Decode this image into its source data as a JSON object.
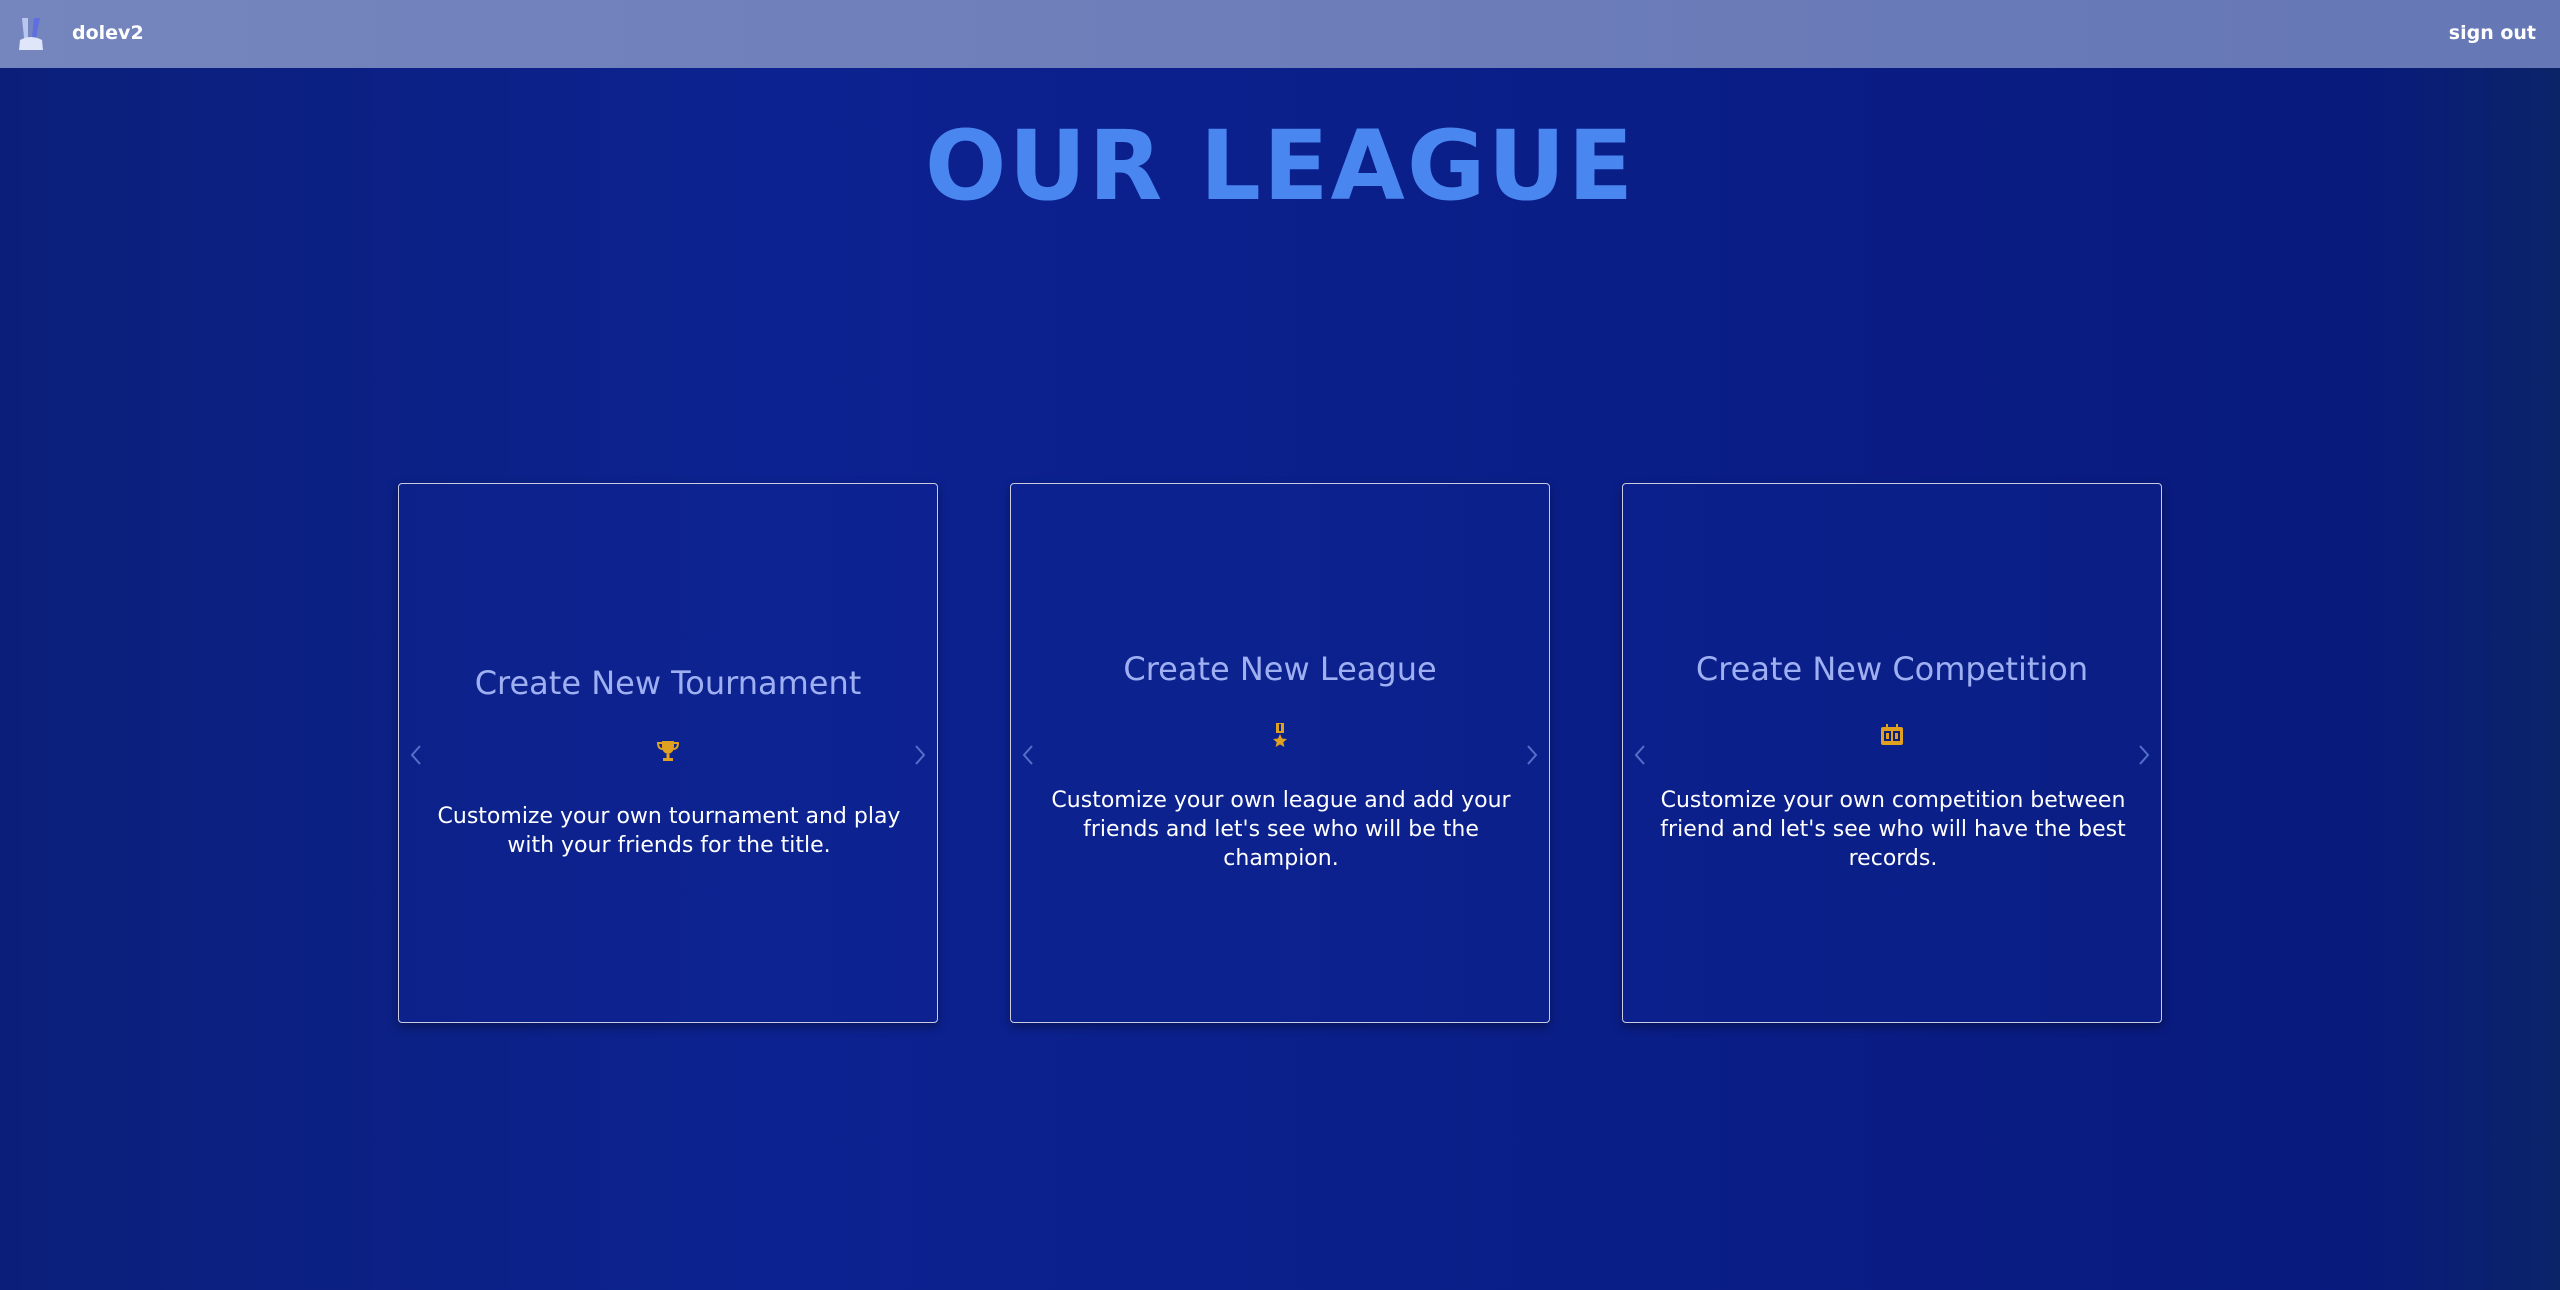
{
  "header": {
    "username": "dolev2",
    "signout_label": "sign out"
  },
  "main": {
    "title": "OUR LEAGUE"
  },
  "cards": [
    {
      "title": "Create New Tournament",
      "icon": "trophy-icon",
      "description": "Customize your own tournament and play with your friends for the title."
    },
    {
      "title": "Create New League",
      "icon": "medal-icon",
      "description": "Customize your own league and add your friends and let's see who will be the champion."
    },
    {
      "title": "Create New Competition",
      "icon": "scoreboard-icon",
      "description": "Customize your own competition between friend and let's see who will have the best records."
    }
  ],
  "colors": {
    "accent": "#4a86f0",
    "icon": "#e0a020",
    "navbar": "#7080bb"
  }
}
